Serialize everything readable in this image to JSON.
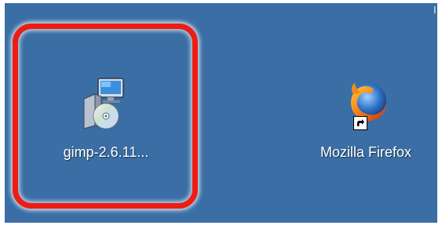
{
  "desktop": {
    "background_color": "#3a6ea5",
    "icons": [
      {
        "label": "gimp-2.6.11...",
        "icon": "installer-icon",
        "selected_highlight": true
      },
      {
        "label": "Mozilla Firefox",
        "icon": "firefox-icon",
        "shortcut": true
      }
    ]
  },
  "highlight": {
    "color": "#ee1c12"
  }
}
